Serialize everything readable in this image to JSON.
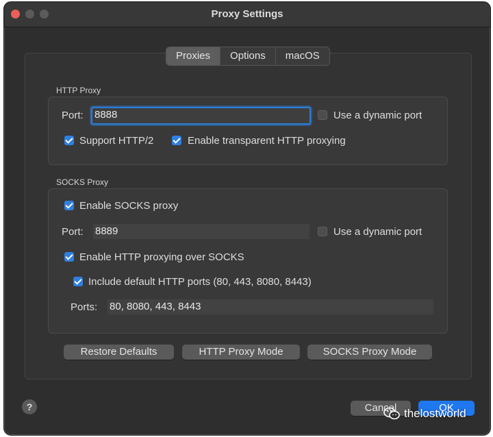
{
  "window": {
    "title": "Proxy Settings"
  },
  "tabs": [
    {
      "label": "Proxies",
      "active": true
    },
    {
      "label": "Options",
      "active": false
    },
    {
      "label": "macOS",
      "active": false
    }
  ],
  "http_proxy": {
    "group_label": "HTTP Proxy",
    "port_label": "Port:",
    "port_value": "8888",
    "dynamic_port_label": "Use a dynamic port",
    "dynamic_port_checked": false,
    "support_http2_label": "Support HTTP/2",
    "support_http2_checked": true,
    "transparent_label": "Enable transparent HTTP proxying",
    "transparent_checked": true
  },
  "socks_proxy": {
    "group_label": "SOCKS Proxy",
    "enable_label": "Enable SOCKS proxy",
    "enable_checked": true,
    "port_label": "Port:",
    "port_value": "8889",
    "dynamic_port_label": "Use a dynamic port",
    "dynamic_port_checked": false,
    "http_over_socks_label": "Enable HTTP proxying over SOCKS",
    "http_over_socks_checked": true,
    "include_default_label": "Include default HTTP ports (80, 443, 8080, 8443)",
    "include_default_checked": true,
    "ports_label": "Ports:",
    "ports_value": "80, 8080, 443, 8443"
  },
  "buttons": {
    "restore": "Restore Defaults",
    "http_mode": "HTTP Proxy Mode",
    "socks_mode": "SOCKS Proxy Mode",
    "cancel": "Cancel",
    "ok": "OK",
    "help": "?"
  },
  "watermark": {
    "text": "thelostworld"
  },
  "colors": {
    "accent": "#2f7fe0",
    "close_button": "#ec5f57",
    "window_bg": "#2e2e2e"
  }
}
